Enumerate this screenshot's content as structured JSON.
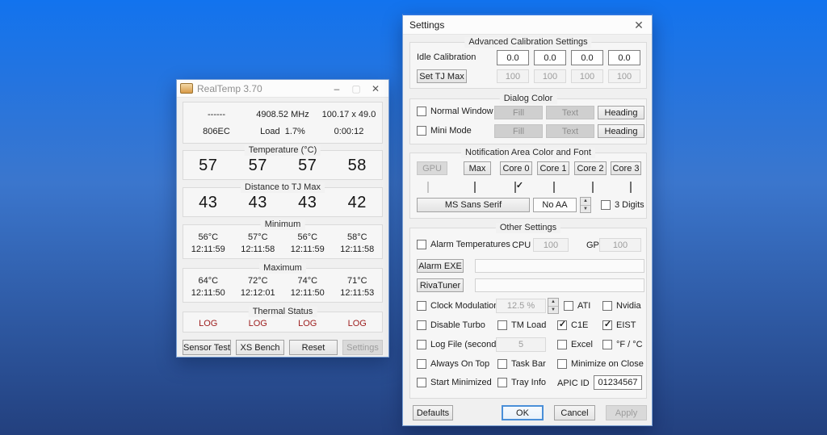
{
  "background": {
    "top_color": "#1273ee",
    "bottom_color": "#23407e"
  },
  "icons": {
    "minimize": "–",
    "maximize": "▢",
    "close_realtemp": "✕",
    "close_settings": "✕"
  },
  "realtemp": {
    "title": "RealTemp 3.70",
    "info": {
      "cpu_dashes": "------",
      "mhz": "4908.52 MHz",
      "multiplier": "100.17 x 49.0",
      "cpuid": "806EC",
      "load_label": "Load",
      "load_value": "1.7%",
      "uptime": "0:00:12"
    },
    "temperature": {
      "label": "Temperature (°C)",
      "values": [
        "57",
        "57",
        "57",
        "58"
      ]
    },
    "distance": {
      "label": "Distance to TJ Max",
      "values": [
        "43",
        "43",
        "43",
        "42"
      ]
    },
    "minimum": {
      "label": "Minimum",
      "temps": [
        "56°C",
        "57°C",
        "56°C",
        "58°C"
      ],
      "times": [
        "12:11:59",
        "12:11:58",
        "12:11:59",
        "12:11:58"
      ]
    },
    "maximum": {
      "label": "Maximum",
      "temps": [
        "64°C",
        "72°C",
        "74°C",
        "71°C"
      ],
      "times": [
        "12:11:50",
        "12:12:01",
        "12:11:50",
        "12:11:53"
      ]
    },
    "thermal": {
      "label": "Thermal Status",
      "values": [
        "LOG",
        "LOG",
        "LOG",
        "LOG"
      ],
      "log_color": "#9d1c1c"
    },
    "buttons": {
      "sensor_test": "Sensor Test",
      "xs_bench": "XS Bench",
      "reset": "Reset",
      "settings": "Settings"
    }
  },
  "settings": {
    "title": "Settings",
    "advanced": {
      "label": "Advanced Calibration Settings",
      "idle_label": "Idle Calibration",
      "idle_values": [
        "0.0",
        "0.0",
        "0.0",
        "0.0"
      ],
      "tjmax_button": "Set TJ Max",
      "tjmax_values": [
        "100",
        "100",
        "100",
        "100"
      ]
    },
    "dialog_color": {
      "label": "Dialog Color",
      "rows": [
        {
          "check": "Normal Window",
          "checked": false,
          "fill": "Fill",
          "text": "Text",
          "heading": "Heading"
        },
        {
          "check": "Mini Mode",
          "checked": false,
          "fill": "Fill",
          "text": "Text",
          "heading": "Heading"
        }
      ]
    },
    "notification": {
      "label": "Notification Area Color and Font",
      "buttons": [
        "GPU",
        "Max",
        "Core 0",
        "Core 1",
        "Core 2",
        "Core 3"
      ],
      "checks": [
        false,
        false,
        true,
        false,
        false,
        false
      ],
      "font_button": "MS Sans Serif",
      "aa_button": "No AA",
      "digits_check": "3 Digits"
    },
    "other": {
      "label": "Other Settings",
      "alarm": {
        "check": "Alarm Temperatures",
        "checked": false,
        "cpu_label": "CPU",
        "cpu_value": "100",
        "gpu_label": "GPU",
        "gpu_value": "100"
      },
      "alarm_exe": {
        "button": "Alarm EXE",
        "value": ""
      },
      "rivatuner": {
        "button": "RivaTuner",
        "value": ""
      },
      "clock": {
        "check": "Clock Modulation",
        "checked": false,
        "value": "12.5 %",
        "ati": "ATI",
        "ati_checked": false,
        "nvidia": "Nvidia",
        "nvidia_checked": false
      },
      "turbo": {
        "disable_turbo": "Disable Turbo",
        "disable_checked": false,
        "tm_load": "TM Load",
        "tm_checked": false,
        "c1e": "C1E",
        "c1e_checked": true,
        "eist": "EIST",
        "eist_checked": true
      },
      "logfile": {
        "check": "Log File (seconds)",
        "checked": false,
        "value": "5",
        "excel": "Excel",
        "excel_checked": false,
        "fc": "°F / °C",
        "fc_checked": false
      },
      "row_top": {
        "always": "Always On Top",
        "always_checked": false,
        "taskbar": "Task Bar",
        "taskbar_checked": false,
        "min_close": "Minimize on Close",
        "min_close_checked": false
      },
      "row_bottom": {
        "start_min": "Start Minimized",
        "start_checked": false,
        "tray": "Tray Info",
        "tray_checked": false,
        "apic_label": "APIC ID",
        "apic_value": "01234567"
      }
    },
    "footer": {
      "defaults": "Defaults",
      "ok": "OK",
      "cancel": "Cancel",
      "apply": "Apply"
    }
  }
}
